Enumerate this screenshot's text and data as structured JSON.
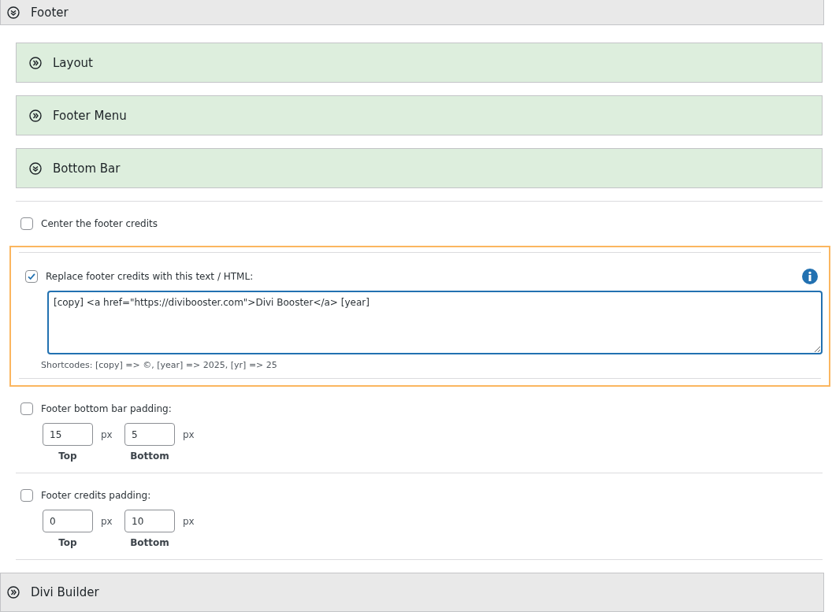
{
  "section": {
    "title": "Footer",
    "expanded": true
  },
  "subsections": [
    {
      "title": "Layout",
      "expanded": false
    },
    {
      "title": "Footer Menu",
      "expanded": false
    },
    {
      "title": "Bottom Bar",
      "expanded": true
    }
  ],
  "options": [
    {
      "kind": "checkbox",
      "label": "Center the footer credits",
      "checked": false,
      "highlighted": false
    },
    {
      "kind": "textarea",
      "label": "Replace footer credits with this text / HTML:",
      "checked": true,
      "highlighted": true,
      "value": "[copy] <a href=\"https://divibooster.com\">Divi Booster</a> [year]",
      "hint": "Shortcodes: [copy] => ©, [year] => 2025, [yr] => 25"
    },
    {
      "kind": "padding",
      "label": "Footer bottom bar padding:",
      "checked": false,
      "highlighted": false,
      "fields": [
        {
          "value": "15",
          "unit": "px",
          "label": "Top"
        },
        {
          "value": "5",
          "unit": "px",
          "label": "Bottom"
        }
      ]
    },
    {
      "kind": "padding",
      "label": "Footer credits padding:",
      "checked": false,
      "highlighted": false,
      "fields": [
        {
          "value": "0",
          "unit": "px",
          "label": "Top"
        },
        {
          "value": "10",
          "unit": "px",
          "label": "Bottom"
        }
      ]
    }
  ],
  "next_section": {
    "title": "Divi Builder",
    "expanded": false
  }
}
